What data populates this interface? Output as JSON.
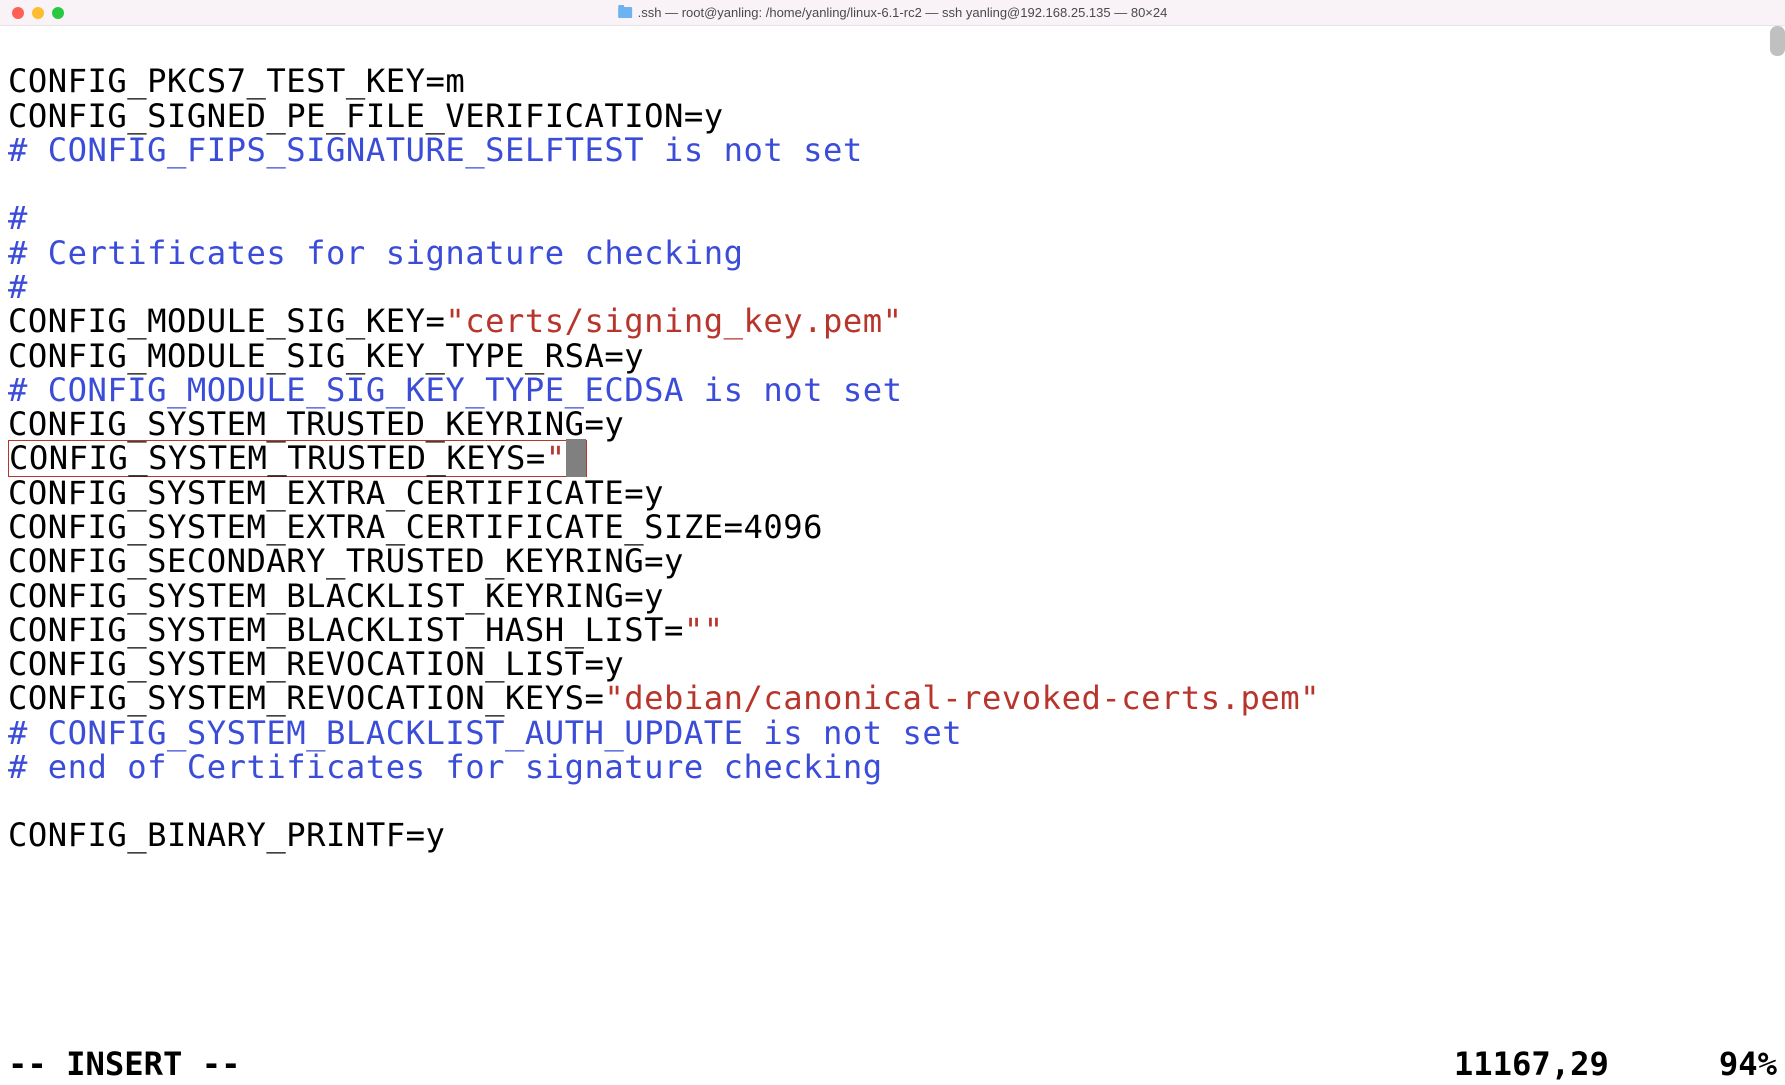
{
  "window": {
    "title": ".ssh — root@yanling: /home/yanling/linux-6.1-rc2 — ssh yanling@192.168.25.135 — 80×24"
  },
  "lines": {
    "l1": "CONFIG_PKCS7_TEST_KEY=m",
    "l2": "CONFIG_SIGNED_PE_FILE_VERIFICATION=y",
    "l3": "# CONFIG_FIPS_SIGNATURE_SELFTEST is not set",
    "l4": "",
    "l5": "#",
    "l6": "# Certificates for signature checking",
    "l7": "#",
    "l8a": "CONFIG_MODULE_SIG_KEY=",
    "l8b": "\"certs/signing_key.pem\"",
    "l9": "CONFIG_MODULE_SIG_KEY_TYPE_RSA=y",
    "l10": "# CONFIG_MODULE_SIG_KEY_TYPE_ECDSA is not set",
    "l11": "CONFIG_SYSTEM_TRUSTED_KEYRING=y",
    "l12a": "CONFIG_SYSTEM_TRUSTED_KEYS=",
    "l12b": "\"",
    "l12c": "\"",
    "l13": "CONFIG_SYSTEM_EXTRA_CERTIFICATE=y",
    "l14": "CONFIG_SYSTEM_EXTRA_CERTIFICATE_SIZE=4096",
    "l15": "CONFIG_SECONDARY_TRUSTED_KEYRING=y",
    "l16": "CONFIG_SYSTEM_BLACKLIST_KEYRING=y",
    "l17a": "CONFIG_SYSTEM_BLACKLIST_HASH_LIST=",
    "l17b": "\"\"",
    "l18": "CONFIG_SYSTEM_REVOCATION_LIST=y",
    "l19a": "CONFIG_SYSTEM_REVOCATION_KEYS=",
    "l19b": "\"debian/canonical-revoked-certs.pem\"",
    "l20": "# CONFIG_SYSTEM_BLACKLIST_AUTH_UPDATE is not set",
    "l21": "# end of Certificates for signature checking",
    "l22": "",
    "l23": "CONFIG_BINARY_PRINTF=y"
  },
  "status": {
    "mode": "-- INSERT --",
    "position": "11167,29",
    "percent": "94%"
  }
}
